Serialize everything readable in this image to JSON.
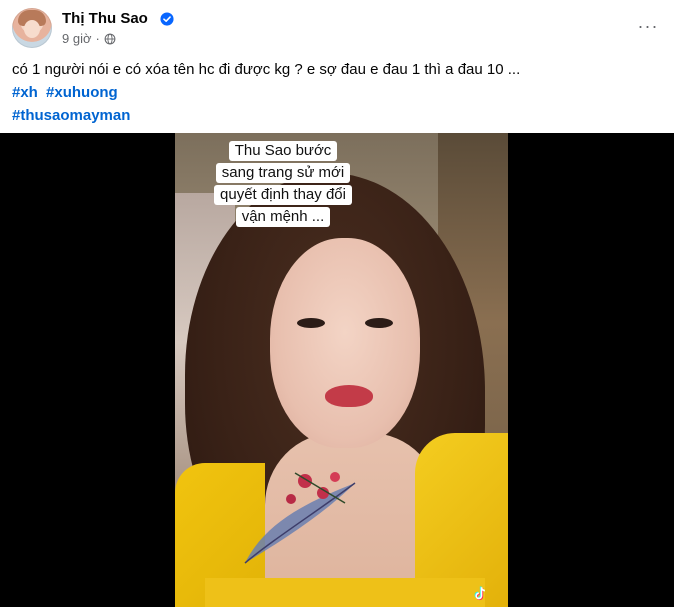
{
  "post": {
    "author": "Thị Thu Sao",
    "time": "9 giờ",
    "text": "có 1 người nói e có xóa tên hc đi được kg ? e sợ đau e đau 1 thì a đau 10 ...",
    "hashtags_line1": [
      "#xh",
      "#xuhuong"
    ],
    "hashtags_line2": [
      "#thusaomayman"
    ],
    "more_label": "···"
  },
  "video": {
    "caption_lines": [
      "Thu Sao bước",
      "sang trang sử mới",
      "quyết định thay đổi",
      "vận mệnh ..."
    ]
  },
  "colors": {
    "link": "#0064d1",
    "verified": "#0866ff",
    "meta": "#65676b",
    "media_bg": "#000000"
  },
  "icons": {
    "verified": "verified-badge-icon",
    "privacy": "globe-icon",
    "more": "more-options-icon",
    "watermark": "tiktok-logo-icon"
  }
}
